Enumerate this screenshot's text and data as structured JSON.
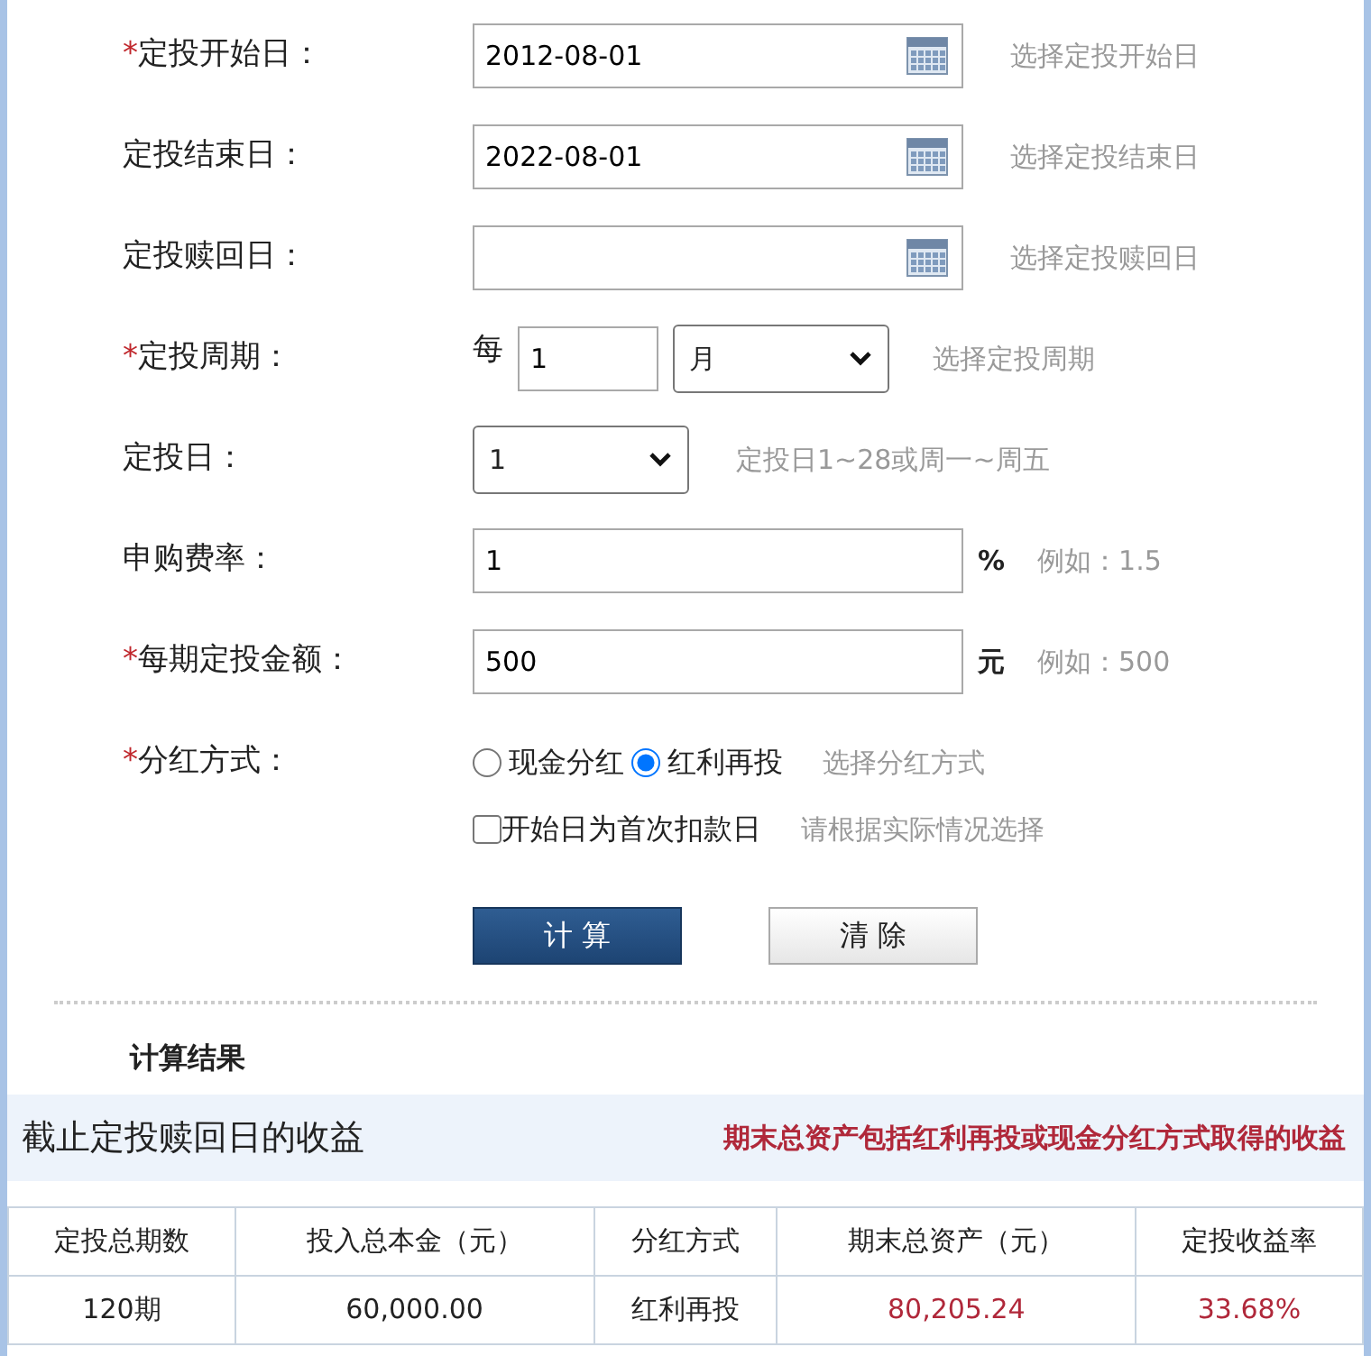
{
  "fields": [
    {
      "kind": "date",
      "marker": "*",
      "label": "定投开始日：",
      "value": "2012-08-01",
      "hint": "选择定投开始日"
    },
    {
      "kind": "date",
      "label": "定投结束日：",
      "value": "2022-08-01",
      "hint": "选择定投结束日"
    },
    {
      "kind": "date",
      "label": "定投赎回日：",
      "hint": "选择定投赎回日"
    },
    {
      "kind": "period",
      "marker": "*",
      "label": "定投周期：",
      "prefix": "每",
      "value": "1",
      "unit_value": "月",
      "hint": "选择定投周期"
    },
    {
      "kind": "select",
      "label": "定投日：",
      "value": "1",
      "hint": "定投日1~28或周一~周五"
    },
    {
      "kind": "text",
      "label": "申购费率：",
      "value": "1",
      "unit": "%",
      "hint": "例如：1.5"
    },
    {
      "kind": "text",
      "marker": "*",
      "label": "每期定投金额：",
      "value": "500",
      "unit": "元",
      "hint": "例如：500"
    },
    {
      "kind": "radio",
      "marker": "*",
      "label": "分红方式：",
      "options": [
        {
          "label": "现金分红",
          "selected": false
        },
        {
          "label": "红利再投",
          "selected": true
        }
      ],
      "hint": "选择分红方式"
    },
    {
      "kind": "checkbox",
      "text": "开始日为首次扣款日",
      "checked": false,
      "hint": "请根据实际情况选择"
    }
  ],
  "buttons": [
    {
      "label": "计 算",
      "kind": "primary"
    },
    {
      "label": "清 除",
      "kind": "default"
    }
  ],
  "results": {
    "title": "计算结果",
    "banner": "截止定投赎回日的收益",
    "note": "期末总资产包括红利再投或现金分红方式取得的收益",
    "columns": [
      {
        "label": "定投总期数",
        "highlight": false
      },
      {
        "label": "投入总本金（元）",
        "highlight": false
      },
      {
        "label": "分红方式",
        "highlight": false
      },
      {
        "label": "期末总资产（元）",
        "highlight": true
      },
      {
        "label": "定投收益率",
        "highlight": true
      }
    ],
    "rows": [
      [
        "120期",
        "60,000.00",
        "红利再投",
        "80,205.24",
        "33.68%"
      ]
    ]
  }
}
